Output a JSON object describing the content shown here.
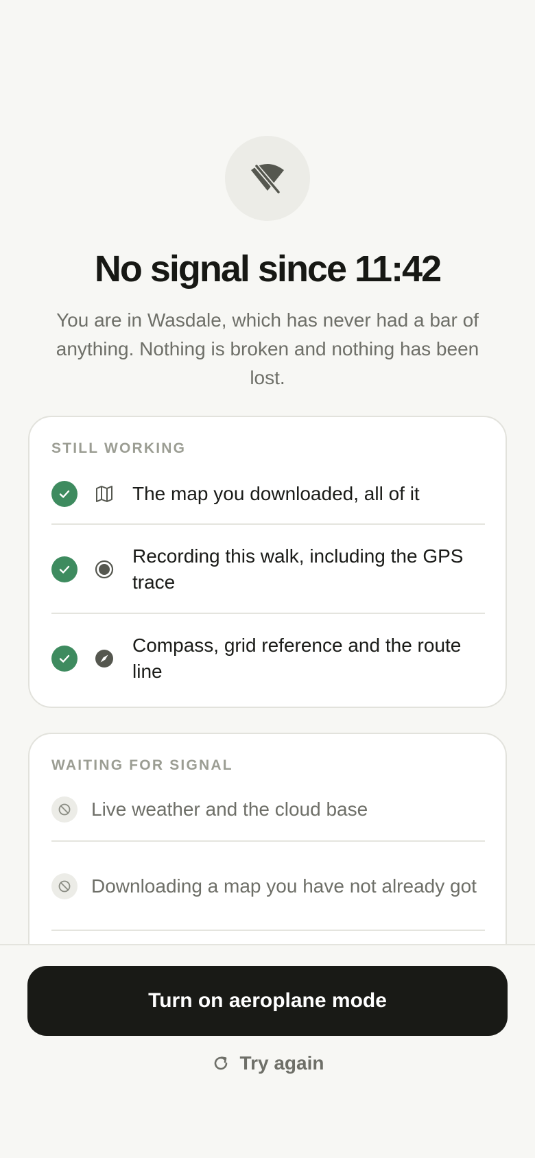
{
  "hero": {
    "icon": "wifi-off-icon",
    "title": "No signal since 11:42",
    "subtitle": "You are in Wasdale, which has never had a bar of anything. Nothing is broken and nothing has been lost."
  },
  "still_working": {
    "label": "STILL WORKING",
    "items": [
      {
        "icon": "map-icon",
        "text": "The map you downloaded, all of it"
      },
      {
        "icon": "record-icon",
        "text": "Recording this walk, including the GPS trace"
      },
      {
        "icon": "compass-icon",
        "text": "Compass, grid reference and the route line"
      }
    ]
  },
  "waiting": {
    "label": "WAITING FOR SIGNAL",
    "items": [
      {
        "icon": "blocked-icon",
        "text": "Live weather and the cloud base"
      },
      {
        "icon": "blocked-icon",
        "text": "Downloading a map you have not already got"
      }
    ]
  },
  "actions": {
    "primary": "Turn on aeroplane mode",
    "retry": "Try again"
  },
  "colors": {
    "background": "#f7f7f4",
    "accent_green": "#3e8b5f",
    "button_dark": "#191a16",
    "muted_text": "#6e6f68"
  }
}
